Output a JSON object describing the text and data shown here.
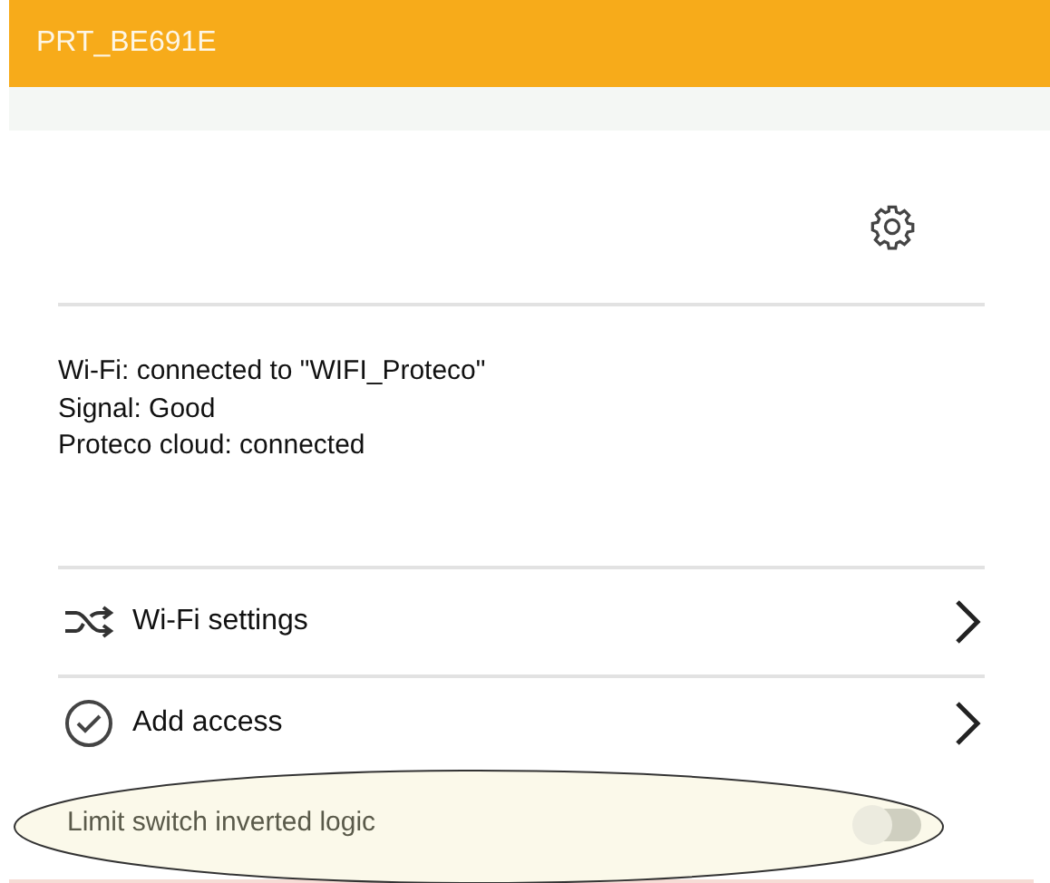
{
  "header": {
    "title": "PRT_BE691E"
  },
  "status_lines": [
    "Wi-Fi: connected to \"WIFI_Proteco\"",
    "Signal: Good",
    "Proteco cloud: connected"
  ],
  "menu": [
    {
      "kind": "shuffle",
      "label": "Wi-Fi settings"
    },
    {
      "kind": "check",
      "label": "Add access"
    }
  ],
  "toggle_row": {
    "label": "Limit switch inverted logic",
    "on": false,
    "highlighted": true
  }
}
